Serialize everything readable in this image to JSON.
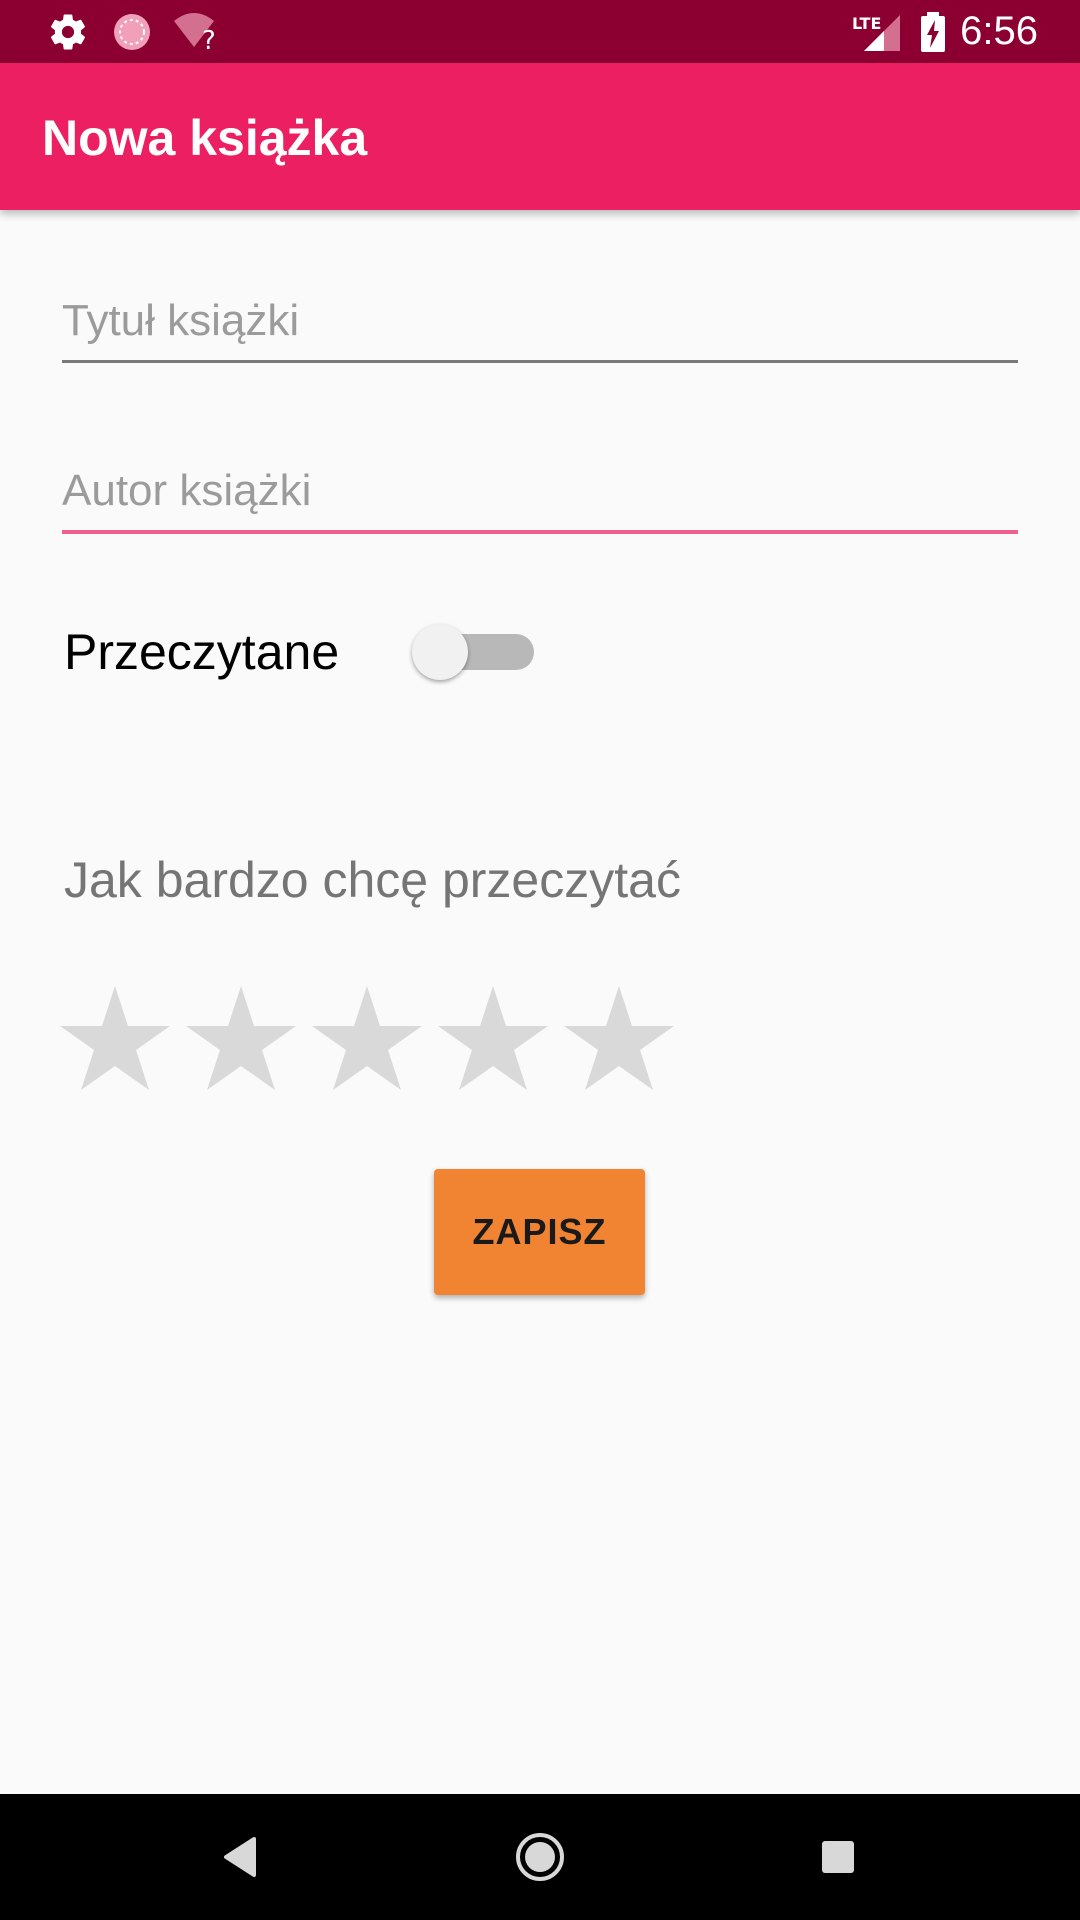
{
  "status_bar": {
    "time": "6:56",
    "icons": [
      "settings-icon",
      "sync-icon",
      "wifi-unknown-icon",
      "lte-signal-icon",
      "battery-charging-icon"
    ]
  },
  "app_bar": {
    "title": "Nowa książka"
  },
  "form": {
    "title_field": {
      "value": "",
      "placeholder": "Tytuł książki"
    },
    "author_field": {
      "value": "",
      "placeholder": "Autor książki"
    },
    "read_switch": {
      "label": "Przeczytane",
      "checked": false
    },
    "rating": {
      "label": "Jak bardzo chcę przeczytać",
      "max": 5,
      "value": 0
    },
    "save_label": "ZAPISZ"
  },
  "nav_bar": {
    "buttons": [
      "back-icon",
      "home-icon",
      "recents-icon"
    ]
  },
  "colors": {
    "status_bar": "#8c0031",
    "app_bar": "#ec1f63",
    "accent": "#f0608c",
    "button": "#f18433",
    "star_empty": "#d9d9d9"
  }
}
